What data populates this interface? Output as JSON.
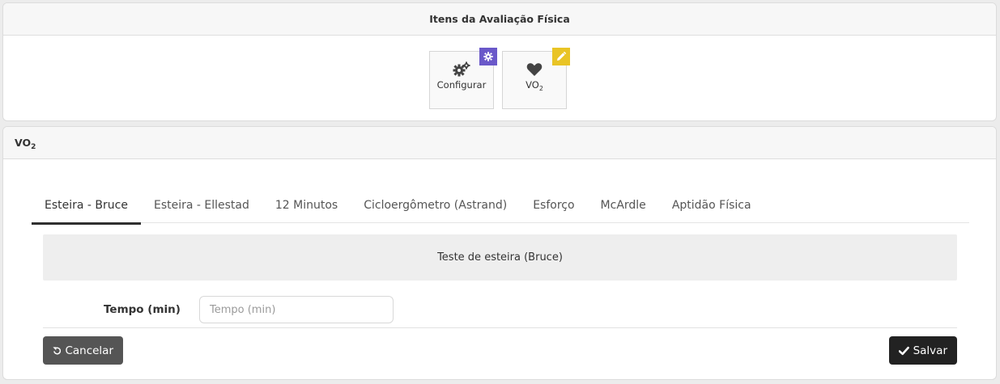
{
  "items_panel": {
    "title": "Itens da Avaliação Física",
    "tiles": [
      {
        "label": "Configurar",
        "icon": "gears-icon",
        "badge_icon": "gear-icon",
        "badge_color": "#6a58c9"
      },
      {
        "label": "VO",
        "label_sub": "2",
        "icon": "heart-icon",
        "badge_icon": "pencil-icon",
        "badge_color": "#e9c425"
      }
    ]
  },
  "vo2_panel": {
    "title": "VO",
    "title_sub": "2",
    "tabs": [
      "Esteira - Bruce",
      "Esteira - Ellestad",
      "12 Minutos",
      "Cicloergômetro (Astrand)",
      "Esforço",
      "McArdle",
      "Aptidão Física"
    ],
    "active_tab": "Esteira - Bruce",
    "info": "Teste de esteira (Bruce)",
    "field": {
      "label": "Tempo (min)",
      "placeholder": "Tempo (min)",
      "value": ""
    },
    "cancel_label": "Cancelar",
    "save_label": "Salvar"
  }
}
